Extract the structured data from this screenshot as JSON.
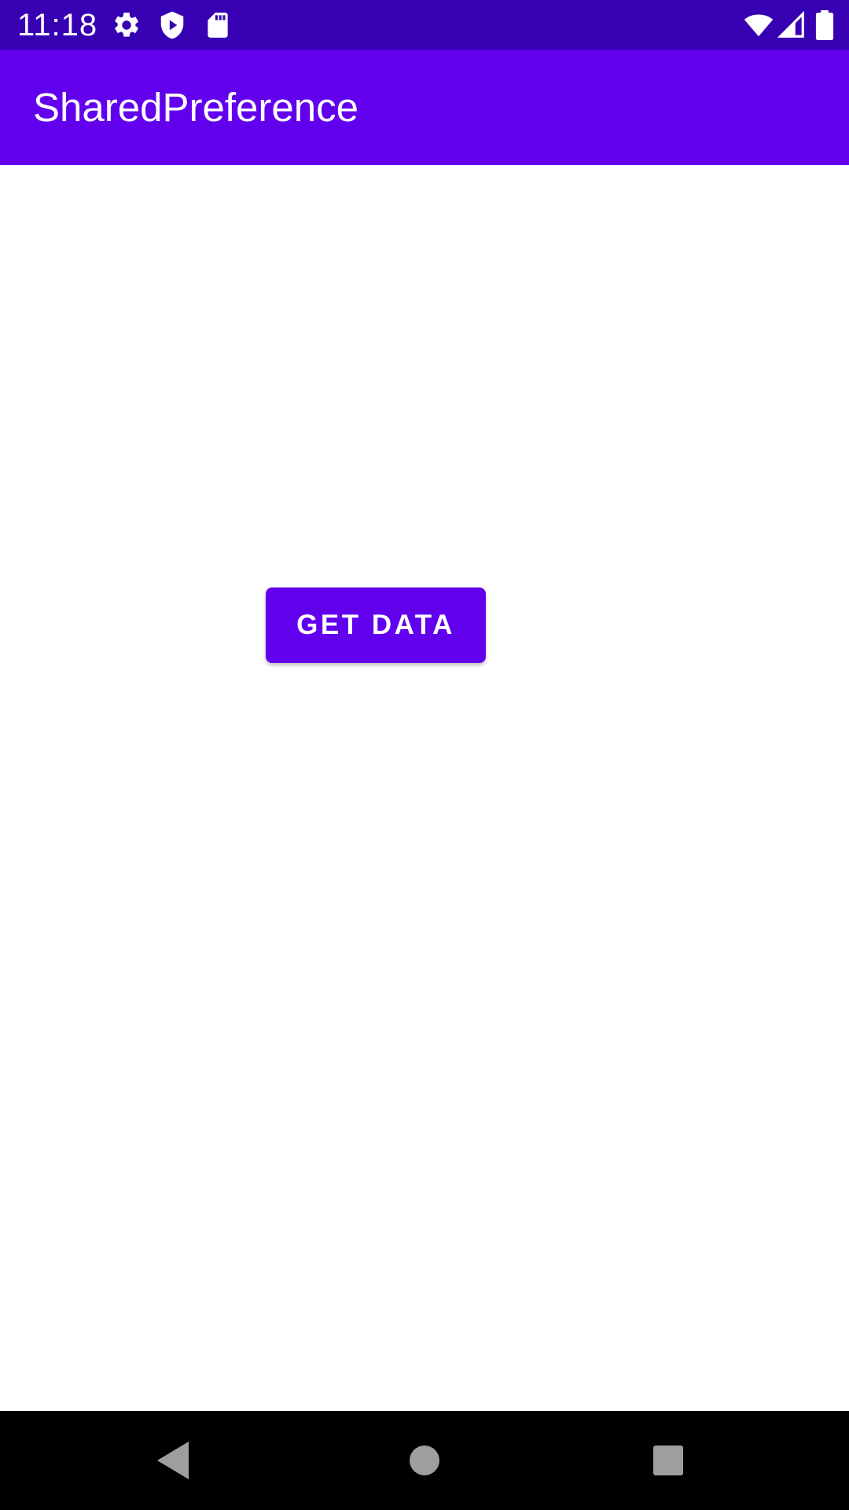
{
  "status_bar": {
    "time": "11:18",
    "background": "#3700b3",
    "left_icons": [
      "settings-icon",
      "shield-play-icon",
      "sd-card-icon"
    ],
    "right_icons": [
      "wifi-icon",
      "cell-signal-icon",
      "battery-icon"
    ]
  },
  "app_bar": {
    "title": "SharedPreference",
    "background": "#6200ee"
  },
  "main": {
    "button_label": "GET DATA",
    "button_color": "#6200ee"
  },
  "nav_bar": {
    "buttons": [
      "back-icon",
      "home-icon",
      "recents-icon"
    ]
  }
}
